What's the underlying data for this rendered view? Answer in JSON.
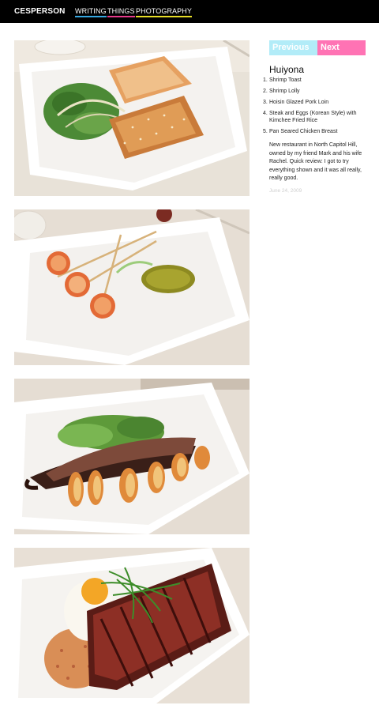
{
  "header": {
    "brand": "CESPERSON",
    "nav": [
      {
        "label": "WRITING",
        "underline": "#36a7e0"
      },
      {
        "label": "THINGS",
        "underline": "#e83a8c"
      },
      {
        "label": "PHOTOGRAPHY",
        "underline": "#e6dc27"
      }
    ]
  },
  "photos": [
    {
      "subject": "Shrimp Toast"
    },
    {
      "subject": "Shrimp Lolly"
    },
    {
      "subject": "Hoisin Glazed Pork Loin"
    },
    {
      "subject": "Steak and Eggs (Korean Style) with Kimchee Fried Rice"
    }
  ],
  "sidebar": {
    "pager": {
      "previous": "Previous",
      "next": "Next",
      "previous_color": "#b2ecf8",
      "next_color": "#ff73b4"
    },
    "title": "Huiyona",
    "items": [
      {
        "num": "1.",
        "text": "Shrimp Toast"
      },
      {
        "num": "2.",
        "text": "Shrimp Lolly"
      },
      {
        "num": "3.",
        "text": "Hoisin Glazed Pork Loin"
      },
      {
        "num": "4.",
        "text": "Steak and Eggs (Korean Style) with Kimchee Fried Rice"
      },
      {
        "num": "5.",
        "text": "Pan Seared Chicken Breast"
      }
    ],
    "review": "New restaurant in North Capitol Hill, owned by my friend Mark and his wife Rachel. Quick review: I got to try everything shown and it was all really, really good.",
    "date": "June 24, 2009"
  }
}
